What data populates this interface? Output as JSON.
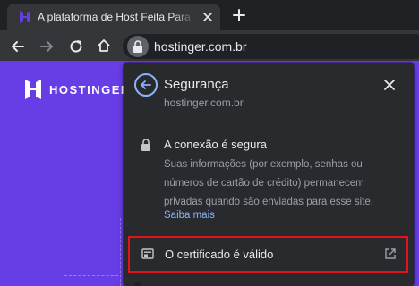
{
  "browser": {
    "tab_title": "A plataforma de Host Feita Para Você",
    "url": "hostinger.com.br"
  },
  "page": {
    "logo_text": "HOSTINGER"
  },
  "security_popup": {
    "title": "Segurança",
    "domain": "hostinger.com.br",
    "connection_title": "A conexão é segura",
    "connection_description": "Suas informações (por exemplo, senhas ou números de cartão de crédito) permanecem privadas quando são enviadas para esse site.",
    "learn_more": "Saiba mais",
    "certificate_label": "O certificado é válido"
  },
  "colors": {
    "page_brand": "#673de6",
    "highlight": "#e1141b",
    "link": "#8ab4f8",
    "popup_bg": "#292a2d"
  },
  "icons": {
    "favicon": "hostinger-favicon-icon",
    "tab_close": "close-icon",
    "new_tab": "plus-icon",
    "back": "arrow-left-icon",
    "forward": "arrow-right-icon",
    "reload": "reload-icon",
    "home": "home-icon",
    "site_info": "lock-icon",
    "popup_back": "arrow-left-icon",
    "popup_close": "close-icon",
    "connection": "lock-icon",
    "certificate": "certificate-icon",
    "external": "external-link-icon"
  }
}
